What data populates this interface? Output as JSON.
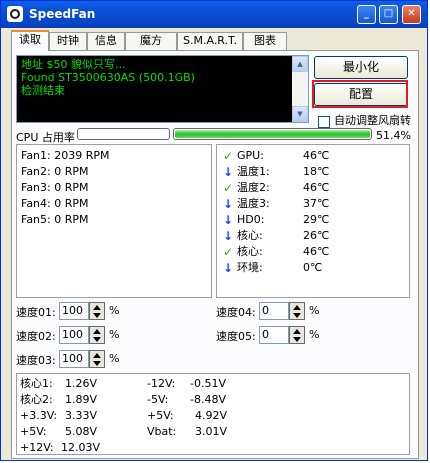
{
  "window": {
    "title": "SpeedFan"
  },
  "tabs": [
    {
      "label": "读取"
    },
    {
      "label": "时钟"
    },
    {
      "label": "信息"
    },
    {
      "label": "魔方"
    },
    {
      "label": "S.M.A.R.T."
    },
    {
      "label": "图表"
    }
  ],
  "log": [
    "地址 $50 貌似只写...",
    "Found ST3500630AS (500.1GB)",
    "检测结束"
  ],
  "buttons": {
    "minimize": "最小化",
    "config": "配置"
  },
  "auto_fan": {
    "label": "自动调整风扇转速",
    "checked": false
  },
  "cpu": {
    "label": "CPU 占用率",
    "core1_percent": 2,
    "core2_percent": 100,
    "total": "51.4%"
  },
  "fans": [
    {
      "label": "Fan1: 2039 RPM"
    },
    {
      "label": "Fan2: 0 RPM"
    },
    {
      "label": "Fan3: 0 RPM"
    },
    {
      "label": "Fan4: 0 RPM"
    },
    {
      "label": "Fan5: 0 RPM"
    }
  ],
  "temps": [
    {
      "icon": "check-icon",
      "label": "GPU:",
      "value": "46℃"
    },
    {
      "icon": "arrow-down-icon",
      "label": "温度1:",
      "value": "18℃"
    },
    {
      "icon": "check-icon",
      "label": "温度2:",
      "value": "46℃"
    },
    {
      "icon": "arrow-down-icon",
      "label": "温度3:",
      "value": "37℃"
    },
    {
      "icon": "arrow-down-icon",
      "label": "HD0:",
      "value": "29℃"
    },
    {
      "icon": "arrow-down-icon",
      "label": "核心:",
      "value": "26℃"
    },
    {
      "icon": "check-icon",
      "label": "核心:",
      "value": "46℃"
    },
    {
      "icon": "arrow-down-icon",
      "label": "环境:",
      "value": "0℃"
    }
  ],
  "speeds": [
    {
      "label": "速度01:",
      "value": "100",
      "unit": "%"
    },
    {
      "label": "速度02:",
      "value": "100",
      "unit": "%"
    },
    {
      "label": "速度03:",
      "value": "100",
      "unit": "%"
    },
    {
      "label": "速度04:",
      "value": "0",
      "unit": "%"
    },
    {
      "label": "速度05:",
      "value": "0",
      "unit": "%"
    }
  ],
  "voltages_left": [
    {
      "label": "核心1:",
      "value": "1.26V"
    },
    {
      "label": "核心2:",
      "value": "1.89V"
    },
    {
      "label": "+3.3V:",
      "value": "3.33V"
    },
    {
      "label": "+5V:",
      "value": "5.08V"
    },
    {
      "label": "+12V:",
      "value": "12.03V"
    }
  ],
  "voltages_right": [
    {
      "label": "-12V:",
      "value": "-0.51V"
    },
    {
      "label": "-5V:",
      "value": "-8.48V"
    },
    {
      "label": "+5V:",
      "value": "4.92V"
    },
    {
      "label": "Vbat:",
      "value": "3.01V"
    }
  ],
  "colors": {
    "check": "#1ea51e",
    "arrow_down": "#1e48e0",
    "highlight": "#e02020",
    "log_text": "#00e000"
  }
}
